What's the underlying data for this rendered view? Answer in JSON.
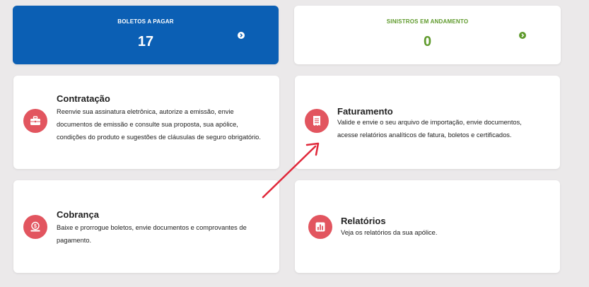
{
  "stats": [
    {
      "title": "BOLETOS A PAGAR",
      "value": "17",
      "bg": "#0b5fb4",
      "fg": "#ffffff",
      "icon": "chevron-right-icon"
    },
    {
      "title": "SINISTROS EM ANDAMENTO",
      "value": "0",
      "bg": "#ffffff",
      "fg": "#5f9a2c",
      "icon": "chevron-right-icon"
    }
  ],
  "tiles": [
    {
      "title": "Contratação",
      "description": "Reenvie sua assinatura eletrônica, autorize a emissão, envie documentos de emissão e consulte sua proposta, sua apólice, condições do produto e sugestões de cláusulas de seguro obrigatório.",
      "icon": "briefcase-icon"
    },
    {
      "title": "Faturamento",
      "description": "Valide e envie o seu arquivo de importação, envie documentos, acesse relatórios analíticos de fatura, boletos e certificados.",
      "icon": "document-icon"
    },
    {
      "title": "Cobrança",
      "description": "Baixe e prorrogue boletos, envie documentos e comprovantes de pagamento.",
      "icon": "money-icon"
    },
    {
      "title": "Relatórios",
      "description": "Veja os relatórios da sua apólice.",
      "icon": "bar-chart-icon"
    }
  ],
  "colors": {
    "accent_red": "#e2555f",
    "brand_blue": "#0b5fb4",
    "green": "#5f9a2c",
    "arrow": "#e0283a"
  }
}
